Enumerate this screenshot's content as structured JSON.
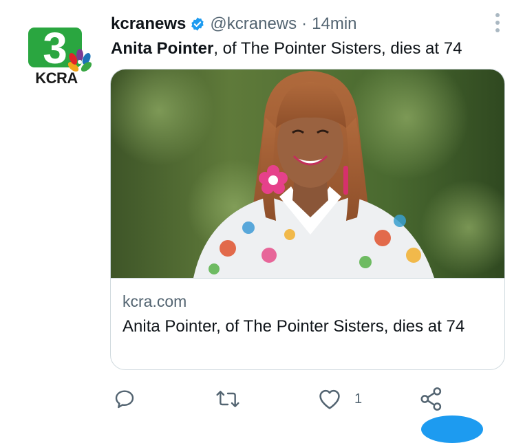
{
  "author": {
    "display_name": "kcranews",
    "handle": "@kcranews",
    "separator": "·",
    "time": "14min",
    "avatar": {
      "channel_number": "3",
      "station": "KCRA",
      "brand_color": "#2aa640"
    }
  },
  "tweet": {
    "text_bold": "Anita Pointer",
    "text_rest": ", of The Pointer Sisters, dies at 74"
  },
  "card": {
    "domain": "kcra.com",
    "title": "Anita Pointer, of The Pointer Sisters, dies at 74"
  },
  "actions": {
    "reply": {
      "icon": "reply-icon"
    },
    "retweet": {
      "icon": "retweet-icon"
    },
    "like": {
      "icon": "heart-icon",
      "count": "1"
    },
    "share": {
      "icon": "share-icon"
    }
  },
  "colors": {
    "accent": "#1d9bf0",
    "text": "#0f1419",
    "muted": "#536471",
    "border": "#cfd9de"
  }
}
